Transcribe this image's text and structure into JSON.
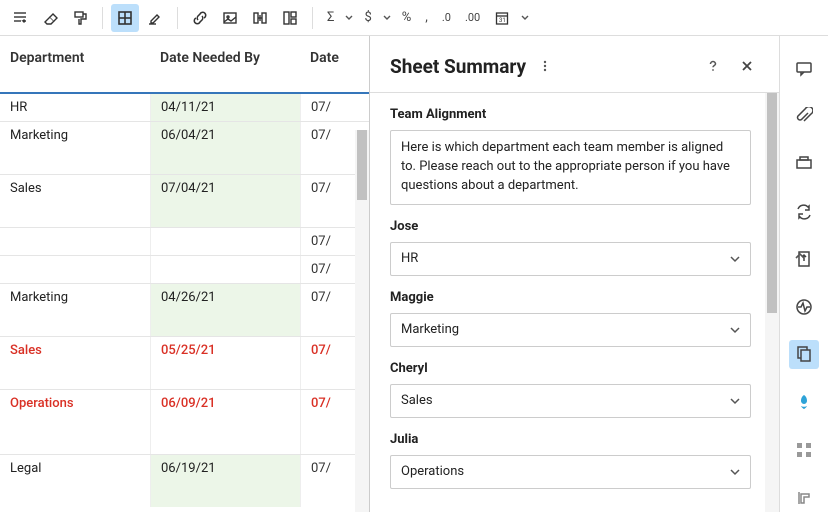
{
  "toolbar": {
    "sigma": "Σ",
    "dollar": "$",
    "percent": "%",
    "comma": ",",
    "dec_dec": ".0",
    "dec_inc": ".00"
  },
  "grid": {
    "headers": {
      "dept": "Department",
      "date": "Date Needed By",
      "date2": "Date"
    },
    "rows": [
      {
        "dept": "HR",
        "date": "04/11/21",
        "date2": "07/",
        "date_bg": "green",
        "h": ""
      },
      {
        "dept": "Marketing",
        "date": "06/04/21",
        "date2": "07/",
        "date_bg": "green",
        "h": "tall2"
      },
      {
        "dept": "Sales",
        "date": "07/04/21",
        "date2": "07/",
        "date_bg": "green",
        "h": "tall2"
      },
      {
        "dept": "",
        "date": "",
        "date2": "07/",
        "date_bg": "",
        "h": ""
      },
      {
        "dept": "",
        "date": "",
        "date2": "07/",
        "date_bg": "",
        "h": ""
      },
      {
        "dept": "Marketing",
        "date": "04/26/21",
        "date2": "07/",
        "date_bg": "green",
        "h": "tall2"
      },
      {
        "dept": "Sales",
        "date": "05/25/21",
        "date2": "07/",
        "date_bg": "",
        "red": true,
        "h": "tall2"
      },
      {
        "dept": "Operations",
        "date": "06/09/21",
        "date2": "07/",
        "date_bg": "",
        "red": true,
        "h": "tall3"
      },
      {
        "dept": "Legal",
        "date": "06/19/21",
        "date2": "07/",
        "date_bg": "green",
        "h": "tall2"
      }
    ]
  },
  "panel": {
    "title": "Sheet Summary",
    "section_label": "Team Alignment",
    "section_text": "Here is which department each team member is aligned to. Please reach out to the appropriate person if you have questions about a department.",
    "people": [
      {
        "name": "Jose",
        "value": "HR"
      },
      {
        "name": "Maggie",
        "value": "Marketing"
      },
      {
        "name": "Cheryl",
        "value": "Sales"
      },
      {
        "name": "Julia",
        "value": "Operations"
      }
    ]
  }
}
